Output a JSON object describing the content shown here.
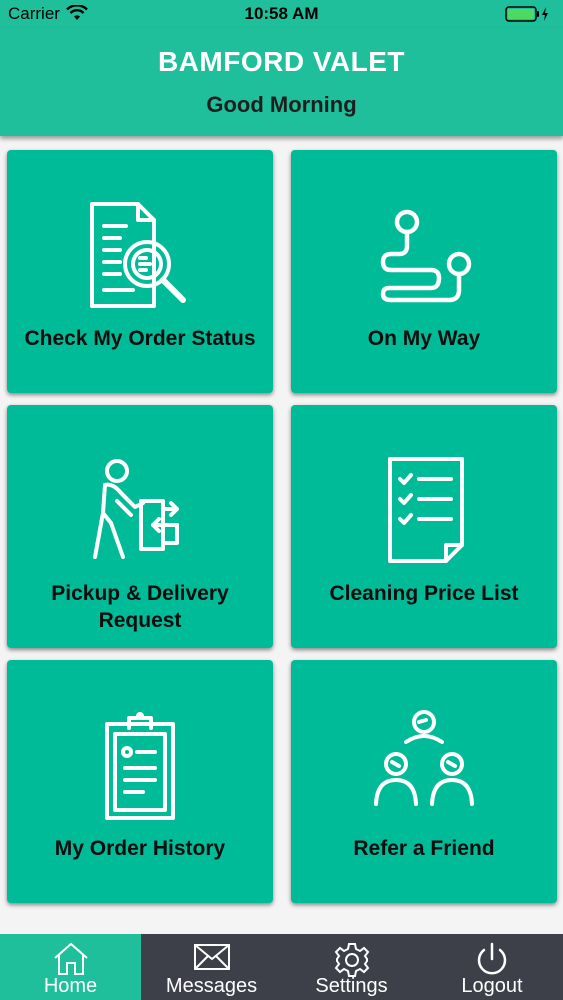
{
  "status_bar": {
    "carrier": "Carrier",
    "time": "10:58 AM"
  },
  "header": {
    "title": "BAMFORD VALET",
    "greeting": "Good Morning"
  },
  "tiles": [
    {
      "label": "Check My Order Status",
      "icon": "document-search-icon"
    },
    {
      "label": "On My Way",
      "icon": "route-icon"
    },
    {
      "label": "Pickup & Delivery Request",
      "icon": "person-pushing-box-icon"
    },
    {
      "label": "Cleaning Price List",
      "icon": "checklist-icon"
    },
    {
      "label": "My Order History",
      "icon": "clipboard-icon"
    },
    {
      "label": "Refer a Friend",
      "icon": "people-network-icon"
    }
  ],
  "tab_bar": {
    "active": "Home",
    "items": [
      {
        "label": "Home",
        "icon": "home-icon"
      },
      {
        "label": "Messages",
        "icon": "envelope-icon"
      },
      {
        "label": "Settings",
        "icon": "gear-icon"
      },
      {
        "label": "Logout",
        "icon": "power-icon"
      }
    ]
  },
  "colors": {
    "header": "#1fbf9c",
    "tile": "#00bb98",
    "tab_bar": "#3d4048",
    "tab_active": "#1fbf9c"
  }
}
